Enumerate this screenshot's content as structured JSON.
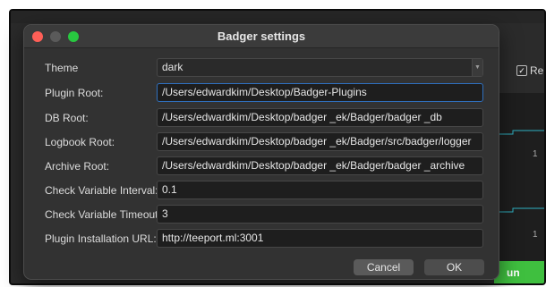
{
  "background": {
    "relative_label": "Relative",
    "relative_checked": true,
    "tick_1": "1",
    "tick_2": "1",
    "run_label": "un"
  },
  "dialog": {
    "title": "Badger settings",
    "fields": [
      {
        "label": "Theme",
        "value": "dark",
        "kind": "select"
      },
      {
        "label": "Plugin Root:",
        "value": "/Users/edwardkim/Desktop/Badger-Plugins",
        "kind": "text",
        "focused": true
      },
      {
        "label": "DB Root:",
        "value": "/Users/edwardkim/Desktop/badger _ek/Badger/badger _db",
        "kind": "text"
      },
      {
        "label": "Logbook Root:",
        "value": "/Users/edwardkim/Desktop/badger _ek/Badger/src/badger/logger",
        "kind": "text"
      },
      {
        "label": "Archive Root:",
        "value": "/Users/edwardkim/Desktop/badger _ek/Badger/badger _archive",
        "kind": "text"
      },
      {
        "label": "Check Variable Interval:",
        "value": "0.1",
        "kind": "text"
      },
      {
        "label": "Check Variable Timeout:",
        "value": "3",
        "kind": "text"
      },
      {
        "label": "Plugin Installation URL:",
        "value": "http://teeport.ml:3001",
        "kind": "text"
      }
    ],
    "cancel_label": "Cancel",
    "ok_label": "OK"
  },
  "colors": {
    "close": "#ff5f57",
    "minimize": "#5a5a5a",
    "maximize": "#28c840",
    "focus_border": "#2f6fbd",
    "run_button": "#3fbf3f"
  }
}
